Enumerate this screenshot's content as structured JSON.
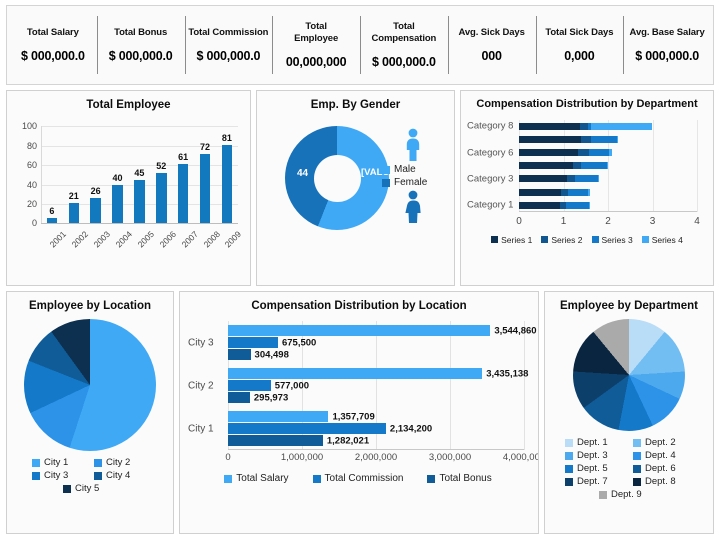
{
  "kpis": [
    {
      "label": "Total Salary",
      "value": "$ 000,000.0"
    },
    {
      "label": "Total Bonus",
      "value": "$ 000,000.0"
    },
    {
      "label": "Total Commission",
      "value": "$ 000,000.0"
    },
    {
      "label": "Total\nEmployee",
      "value": "00,000,000"
    },
    {
      "label": "Total\nCompensation",
      "value": "$ 000,000.0"
    },
    {
      "label": "Avg. Sick Days",
      "value": "000"
    },
    {
      "label": "Total Sick Days",
      "value": "0,000"
    },
    {
      "label": "Avg. Base Salary",
      "value": "$ 000,000.0"
    }
  ],
  "total_employee": {
    "title": "Total Employee"
  },
  "gender": {
    "title": "Emp. By Gender",
    "label_female": "44",
    "label_male": "[VALUE]%",
    "legend": [
      {
        "label": "Male",
        "color": "#3fa9f5"
      },
      {
        "label": "Female",
        "color": "#1772ba"
      }
    ],
    "male_icon_color": "#3fa9f5",
    "female_icon_color": "#1772ba"
  },
  "dept_comp": {
    "title": "Compensation Distribution by Department"
  },
  "emp_location": {
    "title": "Employee by Location"
  },
  "loc_comp": {
    "title": "Compensation Distribution by Location"
  },
  "emp_department": {
    "title": "Employee by Department"
  },
  "chart_data": [
    {
      "id": "total-employee",
      "type": "bar",
      "title": "Total Employee",
      "xlabel": "",
      "ylabel": "",
      "categories": [
        "2001",
        "2002",
        "2003",
        "2004",
        "2005",
        "2006",
        "2007",
        "2008",
        "2009"
      ],
      "values": [
        6,
        21,
        26,
        40,
        45,
        52,
        61,
        72,
        81
      ],
      "ylim": [
        0,
        100
      ],
      "yticks": [
        0,
        20,
        40,
        60,
        80,
        100
      ],
      "grid": true,
      "series_color": "#1379bf",
      "data_labels": true,
      "legend": "none"
    },
    {
      "id": "emp-by-gender",
      "type": "pie",
      "subtype": "doughnut",
      "title": "Emp. By Gender",
      "labels": [
        "Male",
        "Female"
      ],
      "values": [
        56,
        44
      ],
      "displayed_labels": [
        "[VALUE]%",
        "44"
      ],
      "colors": [
        "#3fa9f5",
        "#1772ba"
      ],
      "legend": "right",
      "hole_ratio": 0.45
    },
    {
      "id": "compensation-distribution-by-department",
      "type": "bar",
      "subtype": "stacked-horizontal",
      "title": "Compensation Distribution by Department",
      "categories": [
        "Category 8",
        "",
        "Category 6",
        "",
        "Category 3",
        "",
        "Category 1"
      ],
      "series": [
        {
          "name": "Series 1",
          "color": "#0d2f50",
          "values": [
            1.38,
            1.4,
            1.32,
            1.22,
            1.08,
            0.95,
            0.92
          ]
        },
        {
          "name": "Series 2",
          "color": "#11568f",
          "values": [
            0.18,
            0.22,
            0.25,
            0.18,
            0.18,
            0.16,
            0.14
          ]
        },
        {
          "name": "Series 3",
          "color": "#1479c9",
          "values": [
            0.06,
            0.58,
            0.45,
            0.58,
            0.52,
            0.45,
            0.52
          ]
        },
        {
          "name": "Series 4",
          "color": "#3fa9f5",
          "values": [
            1.38,
            0.03,
            0.08,
            0.02,
            0.02,
            0.04,
            0.02
          ]
        }
      ],
      "xlim": [
        0,
        4
      ],
      "xticks": [
        0,
        1,
        2,
        3,
        4
      ],
      "legend": "bottom",
      "grid": true
    },
    {
      "id": "employee-by-location",
      "type": "pie",
      "title": "Employee by Location",
      "labels": [
        "City 1",
        "City 2",
        "City 3",
        "City 4",
        "City 5"
      ],
      "values": [
        55,
        13,
        13,
        9,
        10
      ],
      "colors": [
        "#3fa9f5",
        "#2d93e8",
        "#1479c9",
        "#0f5c99",
        "#0d2f50"
      ],
      "legend": "bottom"
    },
    {
      "id": "compensation-distribution-by-location",
      "type": "bar",
      "subtype": "grouped-horizontal",
      "title": "Compensation Distribution by Location",
      "categories": [
        "City 3",
        "City 2",
        "City 1"
      ],
      "series": [
        {
          "name": "Total Salary",
          "color": "#3fa9f5",
          "values": [
            3544860,
            3435138,
            1357709
          ]
        },
        {
          "name": "Total Commission",
          "color": "#1479c9",
          "values": [
            675500,
            577000,
            2134200
          ]
        },
        {
          "name": "Total Bonus",
          "color": "#0f5c99",
          "values": [
            304498,
            295973,
            1282021
          ]
        }
      ],
      "data_labels": [
        [
          "3,544,860",
          "675,500",
          "304,498"
        ],
        [
          "3,435,138",
          "577,000",
          "295,973"
        ],
        [
          "1,357,709",
          "2,134,200",
          "1,282,021"
        ]
      ],
      "xlim": [
        0,
        4000000
      ],
      "xticks": [
        0,
        1000000,
        2000000,
        3000000,
        4000000
      ],
      "xticklabels": [
        "0",
        "1,000,000",
        "2,000,000",
        "3,000,000",
        "4,000,000"
      ],
      "legend": "bottom",
      "grid": true
    },
    {
      "id": "employee-by-department",
      "type": "pie",
      "title": "Employee by Department",
      "labels": [
        "Dept. 1",
        "Dept. 2",
        "Dept. 3",
        "Dept. 4",
        "Dept. 5",
        "Dept. 6",
        "Dept. 7",
        "Dept. 8",
        "Dept. 9"
      ],
      "values": [
        11,
        13,
        8,
        11,
        10,
        12,
        11,
        13,
        11
      ],
      "colors": [
        "#b9dcf7",
        "#72bdf2",
        "#4da9ee",
        "#2d93e8",
        "#1479c9",
        "#0f5c99",
        "#0d3f6b",
        "#0a2540",
        "#aaaaaa"
      ],
      "legend": "bottom"
    }
  ]
}
